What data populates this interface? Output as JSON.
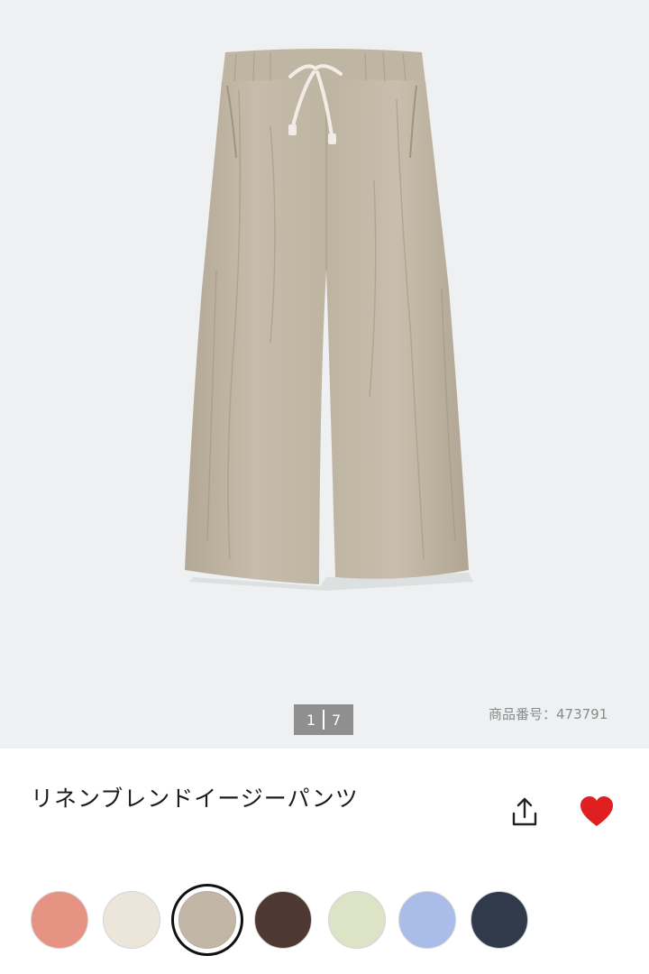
{
  "gallery": {
    "current_page": "1",
    "total_pages": "7",
    "product_number": "商品番号：473791"
  },
  "product": {
    "title": "リネンブレンドイージーパンツ"
  },
  "actions": {
    "share_icon": "share-icon",
    "favorite_icon": "heart-icon",
    "favorite_color": "#e02020"
  },
  "colors": {
    "swatches": [
      {
        "color": "#e69383",
        "selected": false
      },
      {
        "color": "#ece5da",
        "selected": false
      },
      {
        "color": "#c2b6a6",
        "selected": true
      },
      {
        "color": "#4e3832",
        "selected": false
      },
      {
        "color": "#dde3c6",
        "selected": false
      },
      {
        "color": "#a9bde8",
        "selected": false
      },
      {
        "color": "#313a4a",
        "selected": false
      }
    ]
  }
}
